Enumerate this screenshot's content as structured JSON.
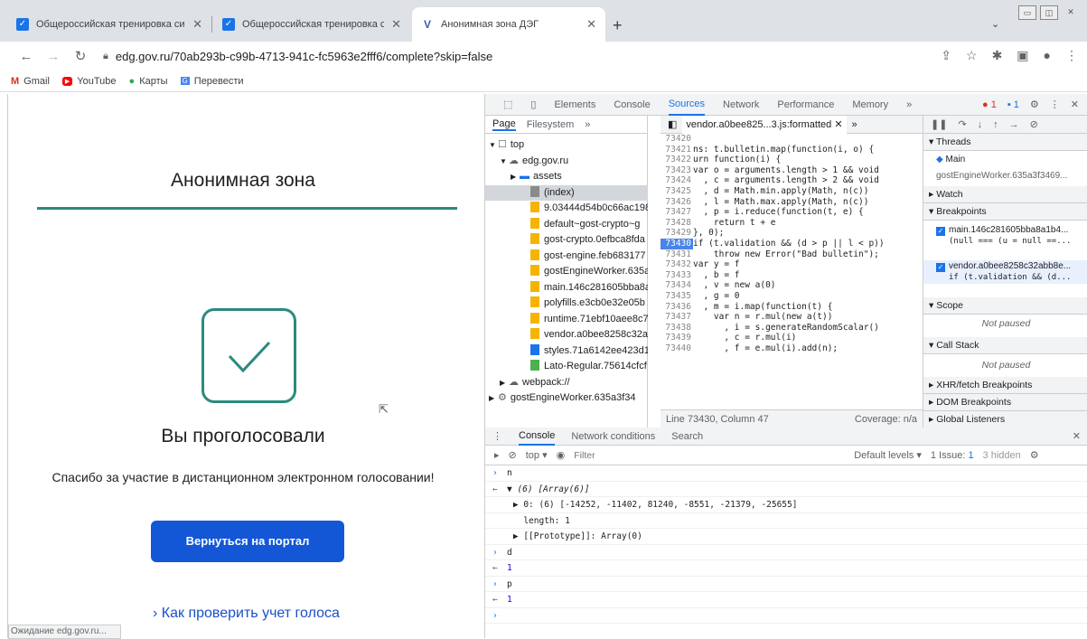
{
  "browser": {
    "tabs": [
      {
        "title": "Общероссийская тренировка систе",
        "favicon": "checkbox-icon"
      },
      {
        "title": "Общероссийская тренировка систе",
        "favicon": "checkbox-icon"
      },
      {
        "title": "Анонимная зона ДЭГ",
        "favicon": "v-logo-icon"
      }
    ],
    "url": "edg.gov.ru/70ab293b-c99b-4713-941c-fc5963e2fff6/complete?skip=false",
    "bookmarks": [
      {
        "label": "Gmail",
        "icon": "gmail-icon"
      },
      {
        "label": "YouTube",
        "icon": "youtube-icon"
      },
      {
        "label": "Карты",
        "icon": "maps-icon"
      },
      {
        "label": "Перевести",
        "icon": "translate-icon"
      }
    ]
  },
  "page": {
    "heading": "Анонимная зона",
    "voted": "Вы проголосовали",
    "thanks": "Спасибо за участие в дистанционном электронном голосовании!",
    "portal_button": "Вернуться на портал",
    "check_link": "Как проверить учет голоса",
    "status": "Ожидание edg.gov.ru..."
  },
  "devtools": {
    "tabs": [
      "Elements",
      "Console",
      "Sources",
      "Network",
      "Performance",
      "Memory"
    ],
    "active_tab": "Sources",
    "more": "»",
    "error_count": "1",
    "message_count": "1",
    "nav_tabs": [
      "Page",
      "Filesystem"
    ],
    "tree": [
      {
        "label": "top",
        "indent": 0,
        "icon": "frame-icon",
        "expand": "▼"
      },
      {
        "label": "edg.gov.ru",
        "indent": 1,
        "icon": "cloud-icon",
        "expand": "▼"
      },
      {
        "label": "assets",
        "indent": 2,
        "icon": "folder-icon",
        "expand": "▶"
      },
      {
        "label": "(index)",
        "indent": 3,
        "icon": "file-gray",
        "expand": "",
        "selected": true
      },
      {
        "label": "9.03444d54b0c66ac198",
        "indent": 3,
        "icon": "file-yellow",
        "expand": ""
      },
      {
        "label": "default~gost-crypto~g",
        "indent": 3,
        "icon": "file-yellow",
        "expand": ""
      },
      {
        "label": "gost-crypto.0efbca8fda",
        "indent": 3,
        "icon": "file-yellow",
        "expand": ""
      },
      {
        "label": "gost-engine.feb683177",
        "indent": 3,
        "icon": "file-yellow",
        "expand": ""
      },
      {
        "label": "gostEngineWorker.635a",
        "indent": 3,
        "icon": "file-yellow",
        "expand": ""
      },
      {
        "label": "main.146c281605bba8a",
        "indent": 3,
        "icon": "file-yellow",
        "expand": ""
      },
      {
        "label": "polyfills.e3cb0e32e05b",
        "indent": 3,
        "icon": "file-yellow",
        "expand": ""
      },
      {
        "label": "runtime.71ebf10aee8c7",
        "indent": 3,
        "icon": "file-yellow",
        "expand": ""
      },
      {
        "label": "vendor.a0bee8258c32a",
        "indent": 3,
        "icon": "file-yellow",
        "expand": ""
      },
      {
        "label": "styles.71a6142ee423d1",
        "indent": 3,
        "icon": "file-blue",
        "expand": ""
      },
      {
        "label": "Lato-Regular.75614cfcf",
        "indent": 3,
        "icon": "file-green",
        "expand": ""
      },
      {
        "label": "webpack://",
        "indent": 1,
        "icon": "cloud-icon",
        "expand": "▶"
      },
      {
        "label": "gostEngineWorker.635a3f34",
        "indent": 0,
        "icon": "gear-icon",
        "expand": "▶"
      }
    ],
    "editor_tab": "vendor.a0bee825...3.js:formatted",
    "code": [
      {
        "ln": "73420",
        "text": ""
      },
      {
        "ln": "73421",
        "text": "ns: t.bulletin.map(function(i, o) {"
      },
      {
        "ln": "73422",
        "text": "urn function(i) {"
      },
      {
        "ln": "73423",
        "text": "var o = arguments.length > 1 && void"
      },
      {
        "ln": "73424",
        "text": "  , c = arguments.length > 2 && void"
      },
      {
        "ln": "73425",
        "text": "  , d = Math.min.apply(Math, n(c))"
      },
      {
        "ln": "73426",
        "text": "  , l = Math.max.apply(Math, n(c))"
      },
      {
        "ln": "73427",
        "text": "  , p = i.reduce(function(t, e) {"
      },
      {
        "ln": "73428",
        "text": "    return t + e"
      },
      {
        "ln": "73429",
        "text": "}, 0);"
      },
      {
        "ln": "73430",
        "text": "if (t.validation && (d > p || l < p))",
        "bp": true
      },
      {
        "ln": "73431",
        "text": "    throw new Error(\"Bad bulletin\");"
      },
      {
        "ln": "73432",
        "text": "var y = f"
      },
      {
        "ln": "73433",
        "text": "  , b = f"
      },
      {
        "ln": "73434",
        "text": "  , v = new a(0)"
      },
      {
        "ln": "73435",
        "text": "  , g = 0"
      },
      {
        "ln": "73436",
        "text": "  , m = i.map(function(t) {"
      },
      {
        "ln": "73437",
        "text": "    var n = r.mul(new a(t))"
      },
      {
        "ln": "73438",
        "text": "      , i = s.generateRandomScalar()"
      },
      {
        "ln": "73439",
        "text": "      , c = r.mul(i)"
      },
      {
        "ln": "73440",
        "text": "      , f = e.mul(i).add(n);"
      }
    ],
    "editor_status": "Line 73430, Column 47",
    "coverage": "Coverage: n/a",
    "debugger": {
      "threads": "Threads",
      "main": "Main",
      "worker": "gostEngineWorker.635a3f3469...",
      "watch": "Watch",
      "breakpoints": "Breakpoints",
      "bp1_file": "main.146c281605bba8a1b4...",
      "bp1_code": "(null === (u = null ==...",
      "bp2_file": "vendor.a0bee8258c32abb8e...",
      "bp2_code": "if (t.validation && (d...",
      "scope": "Scope",
      "not_paused": "Not paused",
      "callstack": "Call Stack",
      "xhr": "XHR/fetch Breakpoints",
      "dom": "DOM Breakpoints",
      "global": "Global Listeners"
    },
    "drawer_tabs": [
      "Console",
      "Network conditions",
      "Search"
    ],
    "console_context": "top ▾",
    "filter_placeholder": "Filter",
    "default_levels": "Default levels ▾",
    "issues": "1 Issue: ",
    "issues_count": "1",
    "hidden": "3 hidden",
    "console_lines": [
      {
        "kind": "input",
        "text": "n"
      },
      {
        "kind": "output",
        "text": "▼ (6) [Array(6)]",
        "italic": true
      },
      {
        "kind": "plain",
        "text": "    ▶ 0: (6) [-14252, -11402, 81240, -8551, -21379, -25655]"
      },
      {
        "kind": "plain",
        "text": "      length: 1"
      },
      {
        "kind": "plain",
        "text": "    ▶ [[Prototype]]: Array(0)"
      },
      {
        "kind": "input",
        "text": "d"
      },
      {
        "kind": "output",
        "text": "1",
        "number": true
      },
      {
        "kind": "input",
        "text": "p"
      },
      {
        "kind": "output",
        "text": "1",
        "number": true
      },
      {
        "kind": "prompt",
        "text": ""
      }
    ]
  }
}
